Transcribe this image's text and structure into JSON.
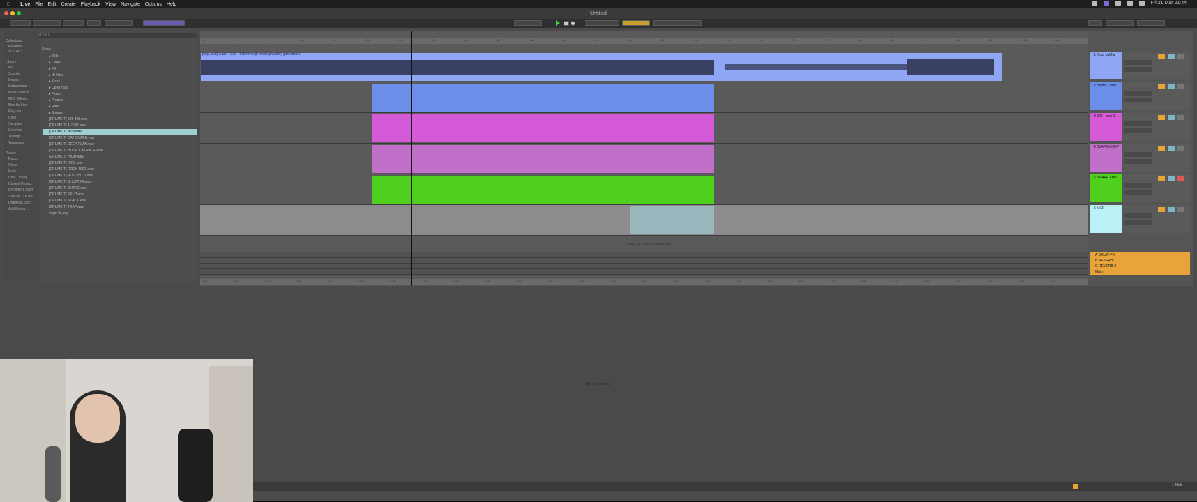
{
  "menubar": {
    "app": "Live",
    "items": [
      "File",
      "Edit",
      "Create",
      "Playback",
      "View",
      "Navigate",
      "Options",
      "Help"
    ],
    "clock": "Fri 21 Mar 21:44"
  },
  "window": {
    "title": "Untitled"
  },
  "browser": {
    "search_placeholder": "Search (Cmd + F)",
    "collections_title": "Collections",
    "collections": [
      "Favorites",
      "VOCALS"
    ],
    "library_title": "Library",
    "library": [
      "All",
      "Sounds",
      "Drums",
      "Instruments",
      "Audio Effects",
      "MIDI Effects",
      "Max for Live",
      "Plug-Ins",
      "Clips",
      "Samples",
      "Grooves",
      "Tunings",
      "Templates"
    ],
    "places_title": "Places",
    "places": [
      "Packs",
      "Cloud",
      "Push",
      "User Library",
      "Current Project",
      "DRUMKIT 2024",
      "VIRGIN LOOPS",
      "DrumKits.com",
      "Add Folder..."
    ],
    "name_header": "Name",
    "folders": [
      "808s",
      "Claps",
      "FX",
      "Hi-Hats",
      "Kicks",
      "Open Hats",
      "Percs",
      "Presets",
      "Rims",
      "Snares"
    ],
    "files": [
      "[DRUMKIT] 808 808.wav",
      "[DRUMKIT] AUDIO.wav",
      "[DRUMKIT] BZB.wav",
      "[DRUMKIT] CAT SNARE.wav",
      "[DRUMKIT] DEEP PLAN.wav",
      "[DRUMKIT] HIT ROOM RACE.wav",
      "[DRUMKIT] HIGH.wav",
      "[DRUMKIT] KICK.wav",
      "[DRUMKIT] ROCK RIDE.wav",
      "[DRUMKIT] ROLL HIT 1.wav",
      "[DRUMKIT] SHUTTER.wav",
      "[DRUMKIT] SNARE.wav",
      "[DRUMKIT] SPLIT.wav",
      "[DRUMKIT] STACK.wav",
      "[DRUMKIT] TRAP.wav"
    ],
    "extra": "virgin kit.png"
  },
  "arrangement": {
    "audio_clip_label": "[hop, outl]-audio - Edit - 138 fave (dj mashup/audio) (pro edition)",
    "drop_hint": "Drop Files and Devices Here",
    "bar_numbers": [
      "1",
      "5",
      "9",
      "13",
      "17",
      "21",
      "25",
      "29",
      "33",
      "37",
      "41",
      "45",
      "49",
      "53",
      "57",
      "61",
      "65",
      "69",
      "73",
      "77",
      "81",
      "85",
      "89",
      "93",
      "97",
      "101",
      "105"
    ],
    "time_ticks": [
      "0:00",
      "0:10",
      "0:20",
      "0:30",
      "0:40",
      "0:50",
      "1:00",
      "1:10",
      "1:20",
      "1:30",
      "1:40",
      "1:50",
      "2:00",
      "2:10",
      "2:20",
      "2:30",
      "2:40",
      "2:50",
      "3:00",
      "3:10",
      "3:20",
      "3:30",
      "3:40",
      "3:50",
      "4:00",
      "4:10",
      "4:20",
      "4:30"
    ]
  },
  "tracks": [
    {
      "name": "1 [hop, outl]-a",
      "color": "#8fa6f4"
    },
    {
      "name": "2 Hi-Hat - loop",
      "color": "#6b8fe8"
    },
    {
      "name": "3 808 - loop 1",
      "color": "#d45ad8"
    },
    {
      "name": "4 CLAPS-LOOP",
      "color": "#c070c8"
    },
    {
      "name": "5 SNARE 4BD",
      "color": "#4fd01f"
    },
    {
      "name": "6 MIDI",
      "color": "#b9f1f7"
    }
  ],
  "returns": [
    {
      "name": "A DELAY-FX",
      "color": "#e8a43a"
    },
    {
      "name": "B REVERB-1",
      "color": "#e8a43a"
    },
    {
      "name": "C REVERB-2",
      "color": "#e8a43a"
    },
    {
      "name": "Main",
      "color": "#e8a43a"
    }
  ],
  "detail": {
    "message": "No clip selected."
  },
  "statusbar": {
    "track": "1-Midi"
  }
}
